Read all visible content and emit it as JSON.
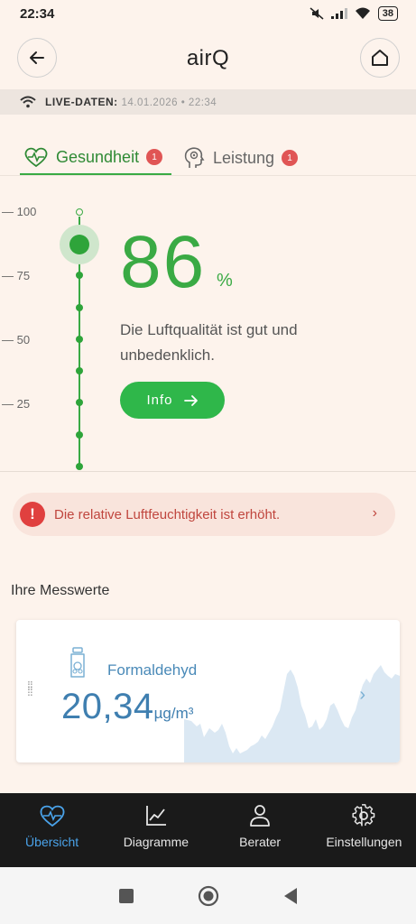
{
  "status_bar": {
    "time": "22:34",
    "battery": "38"
  },
  "header": {
    "title": "airQ"
  },
  "live": {
    "label": "LIVE-DATEN:",
    "timestamp": "14.01.2026 • 22:34"
  },
  "tabs": [
    {
      "label": "Gesundheit",
      "badge": "1",
      "active": true
    },
    {
      "label": "Leistung",
      "badge": "1",
      "active": false
    }
  ],
  "scale": {
    "labels": [
      "— 100",
      "— 75",
      "— 50",
      "— 25"
    ]
  },
  "score": {
    "value": "86",
    "unit": "%",
    "description": "Die Luftqualität ist gut und unbedenklich.",
    "info_label": "Info"
  },
  "alert": {
    "icon": "!",
    "text": "Die relative Luftfeuchtigkeit ist erhöht."
  },
  "measurements": {
    "title": "Ihre Messwerte",
    "card": {
      "name": "Formaldehyd",
      "value": "20,34",
      "unit": "µg/m³"
    }
  },
  "bottom_nav": [
    {
      "label": "Übersicht",
      "icon": "heart-pulse-icon",
      "active": true
    },
    {
      "label": "Diagramme",
      "icon": "chart-icon",
      "active": false
    },
    {
      "label": "Berater",
      "icon": "person-icon",
      "active": false
    },
    {
      "label": "Einstellungen",
      "icon": "gear-icon",
      "active": false
    }
  ],
  "colors": {
    "accent_green": "#3aaa44",
    "alert_red": "#e0403f",
    "accent_blue": "#4aa3ea",
    "nav_bg": "#1a1a1a"
  }
}
